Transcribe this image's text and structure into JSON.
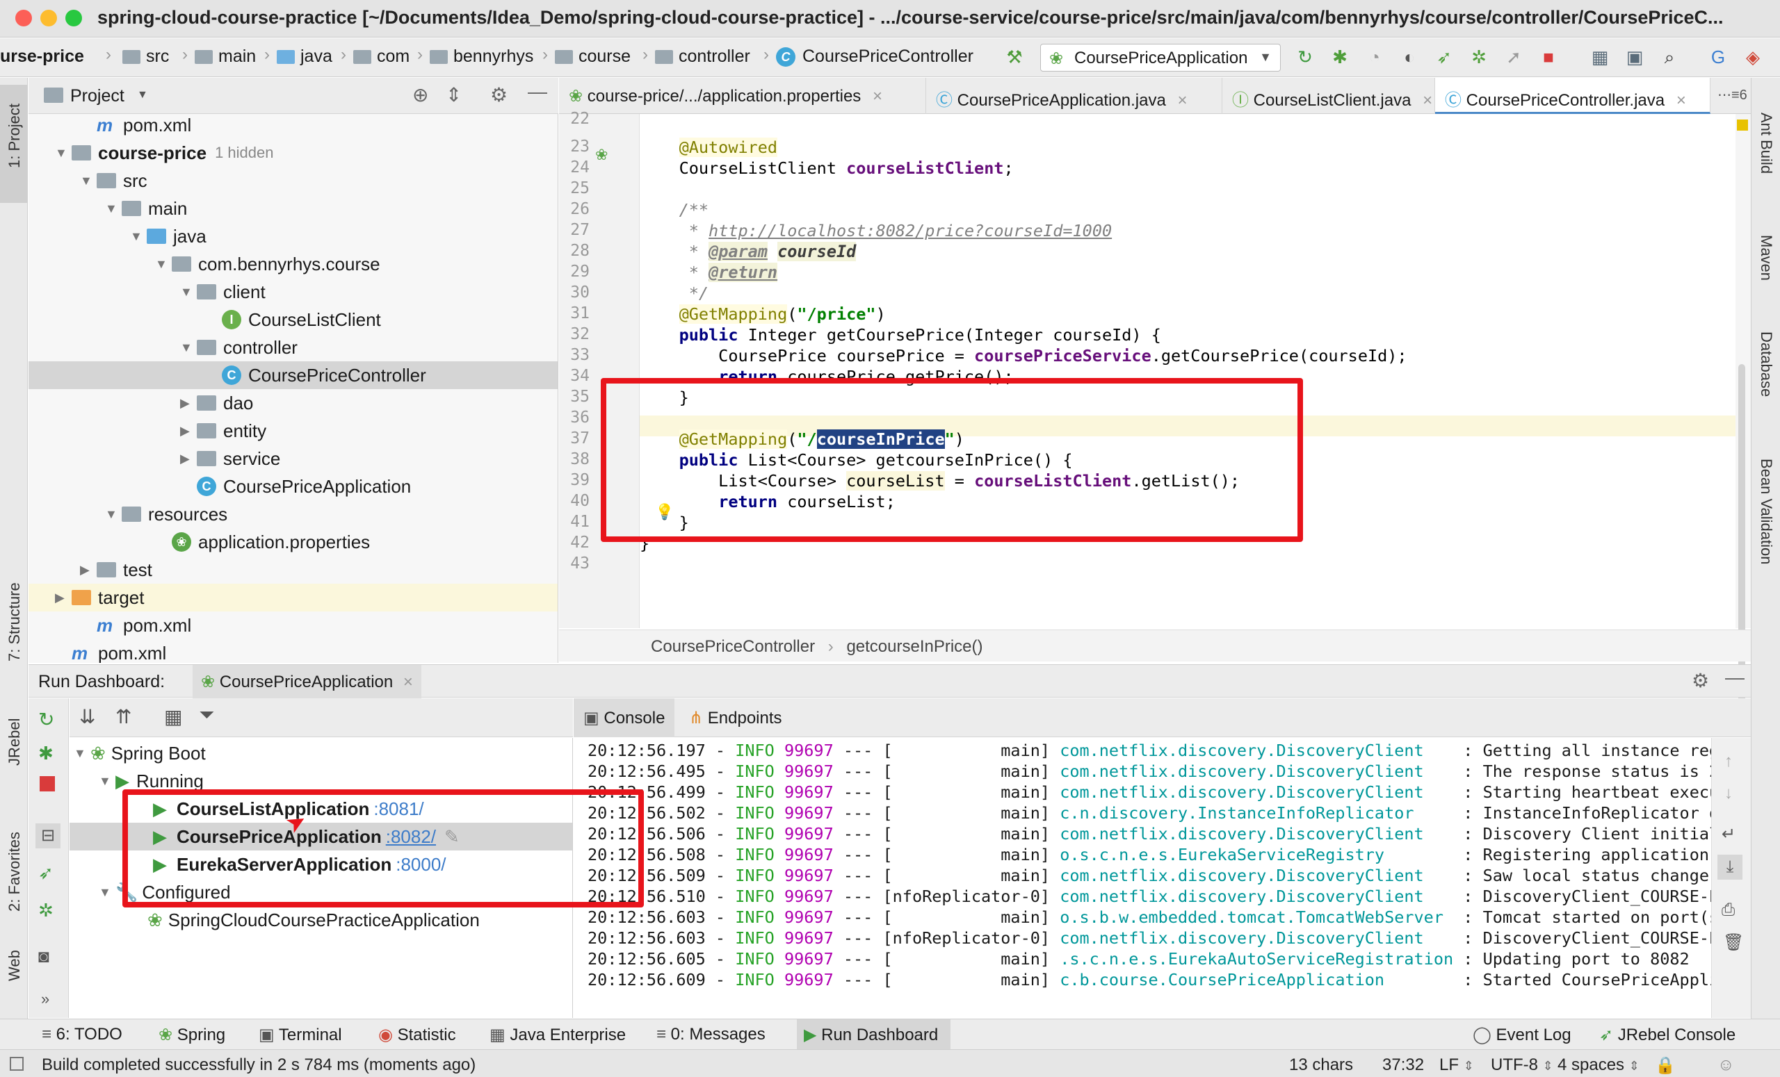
{
  "window": {
    "title": "spring-cloud-course-practice [~/Documents/Idea_Demo/spring-cloud-course-practice] - .../course-service/course-price/src/main/java/com/bennyrhys/course/controller/CoursePriceC..."
  },
  "nav": {
    "crumbs": [
      "urse-price",
      "src",
      "main",
      "java",
      "com",
      "bennyrhys",
      "course",
      "controller",
      "CoursePriceController"
    ],
    "run_config": "CoursePriceApplication"
  },
  "left_strip": {
    "project": "1: Project",
    "structure": "7: Structure",
    "jrebel": "JRebel",
    "favorites": "2: Favorites",
    "web": "Web"
  },
  "right_strip": {
    "ant": "Ant Build",
    "maven": "Maven",
    "database": "Database",
    "bean": "Bean Validation"
  },
  "project": {
    "title": "Project",
    "tree": [
      {
        "label": "pom.xml",
        "indent": 4,
        "icon": "m"
      },
      {
        "label": "course-price",
        "hint": "1 hidden",
        "indent": 3,
        "icon": "fold",
        "tri": "down",
        "bold": true
      },
      {
        "label": "src",
        "indent": 4,
        "icon": "fold",
        "tri": "down"
      },
      {
        "label": "main",
        "indent": 5,
        "icon": "fold",
        "tri": "down"
      },
      {
        "label": "java",
        "indent": 6,
        "icon": "fold-blue",
        "tri": "down"
      },
      {
        "label": "com.bennyrhys.course",
        "indent": 7,
        "icon": "fold",
        "tri": "down"
      },
      {
        "label": "client",
        "indent": 8,
        "icon": "fold",
        "tri": "down"
      },
      {
        "label": "CourseListClient",
        "indent": 9,
        "icon": "I"
      },
      {
        "label": "controller",
        "indent": 8,
        "icon": "fold",
        "tri": "down"
      },
      {
        "label": "CoursePriceController",
        "indent": 9,
        "icon": "C",
        "selected": true
      },
      {
        "label": "dao",
        "indent": 8,
        "icon": "fold",
        "tri": "right"
      },
      {
        "label": "entity",
        "indent": 8,
        "icon": "fold",
        "tri": "right"
      },
      {
        "label": "service",
        "indent": 8,
        "icon": "fold",
        "tri": "right"
      },
      {
        "label": "CoursePriceApplication",
        "indent": 8,
        "icon": "S"
      },
      {
        "label": "resources",
        "indent": 5,
        "icon": "fold",
        "tri": "down"
      },
      {
        "label": "application.properties",
        "indent": 7,
        "icon": "P"
      },
      {
        "label": "test",
        "indent": 4,
        "icon": "fold",
        "tri": "right"
      },
      {
        "label": "target",
        "indent": 3,
        "icon": "fold-orange",
        "tri": "right",
        "highlight": true
      },
      {
        "label": "pom.xml",
        "indent": 4,
        "icon": "m"
      },
      {
        "label": "pom.xml",
        "indent": 3,
        "icon": "m"
      }
    ]
  },
  "editor": {
    "tabs": [
      {
        "label": "course-price/.../application.properties",
        "active": false
      },
      {
        "label": "CoursePriceApplication.java",
        "active": false
      },
      {
        "label": "CourseListClient.java",
        "active": false
      },
      {
        "label": "CoursePriceController.java",
        "active": true
      }
    ],
    "tab_overflow": "6",
    "line_numbers": [
      "22",
      "23",
      "24",
      "25",
      "26",
      "27",
      "28",
      "29",
      "30",
      "31",
      "32",
      "33",
      "34",
      "35",
      "36",
      "37",
      "38",
      "39",
      "40",
      "41",
      "42",
      "43"
    ],
    "breadcrumb": [
      "CoursePriceController",
      "getcourseInPrice()"
    ]
  },
  "run_dashboard": {
    "title": "Run Dashboard:",
    "tab": "CoursePriceApplication",
    "tree": {
      "spring_boot": "Spring Boot",
      "running": "Running",
      "apps": [
        {
          "name": "CourseListApplication",
          "port": ":8081/"
        },
        {
          "name": "CoursePriceApplication",
          "port": ":8082/"
        },
        {
          "name": "EurekaServerApplication",
          "port": ":8000/"
        }
      ],
      "configured": "Configured",
      "configured_app": "SpringCloudCoursePracticeApplication"
    },
    "console_tabs": {
      "console": "Console",
      "endpoints": "Endpoints"
    },
    "console_lines": [
      {
        "time": "20:12:56.197",
        "thread": "[           main]",
        "cls": "com.netflix.discovery.DiscoveryClient   ",
        "msg": ": Getting all instance reg"
      },
      {
        "time": "20:12:56.495",
        "thread": "[           main]",
        "cls": "com.netflix.discovery.DiscoveryClient   ",
        "msg": ": The response status is 20"
      },
      {
        "time": "20:12:56.499",
        "thread": "[           main]",
        "cls": "com.netflix.discovery.DiscoveryClient   ",
        "msg": ": Starting heartbeat execu"
      },
      {
        "time": "20:12:56.502",
        "thread": "[           main]",
        "cls": "c.n.discovery.InstanceInfoReplicator    ",
        "msg": ": InstanceInfoReplicator o"
      },
      {
        "time": "20:12:56.506",
        "thread": "[           main]",
        "cls": "com.netflix.discovery.DiscoveryClient   ",
        "msg": ": Discovery Client initial"
      },
      {
        "time": "20:12:56.508",
        "thread": "[           main]",
        "cls": "o.s.c.n.e.s.EurekaServiceRegistry       ",
        "msg": ": Registering application C"
      },
      {
        "time": "20:12:56.509",
        "thread": "[           main]",
        "cls": "com.netflix.discovery.DiscoveryClient   ",
        "msg": ": Saw local status change e"
      },
      {
        "time": "20:12:56.510",
        "thread": "[nfoReplicator-0]",
        "cls": "com.netflix.discovery.DiscoveryClient   ",
        "msg": ": DiscoveryClient_COURSE-PR"
      },
      {
        "time": "20:12:56.603",
        "thread": "[           main]",
        "cls": "o.s.b.w.embedded.tomcat.TomcatWebServer ",
        "msg": ": Tomcat started on port(s"
      },
      {
        "time": "20:12:56.603",
        "thread": "[nfoReplicator-0]",
        "cls": "com.netflix.discovery.DiscoveryClient   ",
        "msg": ": DiscoveryClient_COURSE-PR"
      },
      {
        "time": "20:12:56.605",
        "thread": "[           main]",
        "cls": ".s.c.n.e.s.EurekaAutoServiceRegistration",
        "msg": ": Updating port to 8082"
      },
      {
        "time": "20:12:56.609",
        "thread": "[           main]",
        "cls": "c.b.course.CoursePriceApplication       ",
        "msg": ": Started CoursePriceApplic"
      }
    ],
    "console_level": "INFO",
    "console_pid": "99697",
    "console_dash": "---"
  },
  "tool_tabs": {
    "todo": "6: TODO",
    "spring": "Spring",
    "terminal": "Terminal",
    "statistic": "Statistic",
    "java_enterprise": "Java Enterprise",
    "messages": "0: Messages",
    "run_dashboard": "Run Dashboard",
    "event_log": "Event Log",
    "jrebel_console": "JRebel Console"
  },
  "status": {
    "message": "Build completed successfully in 2 s 784 ms (moments ago)",
    "chars": "13 chars",
    "position": "37:32",
    "line_sep": "LF",
    "encoding": "UTF-8",
    "indent": "4 spaces"
  }
}
